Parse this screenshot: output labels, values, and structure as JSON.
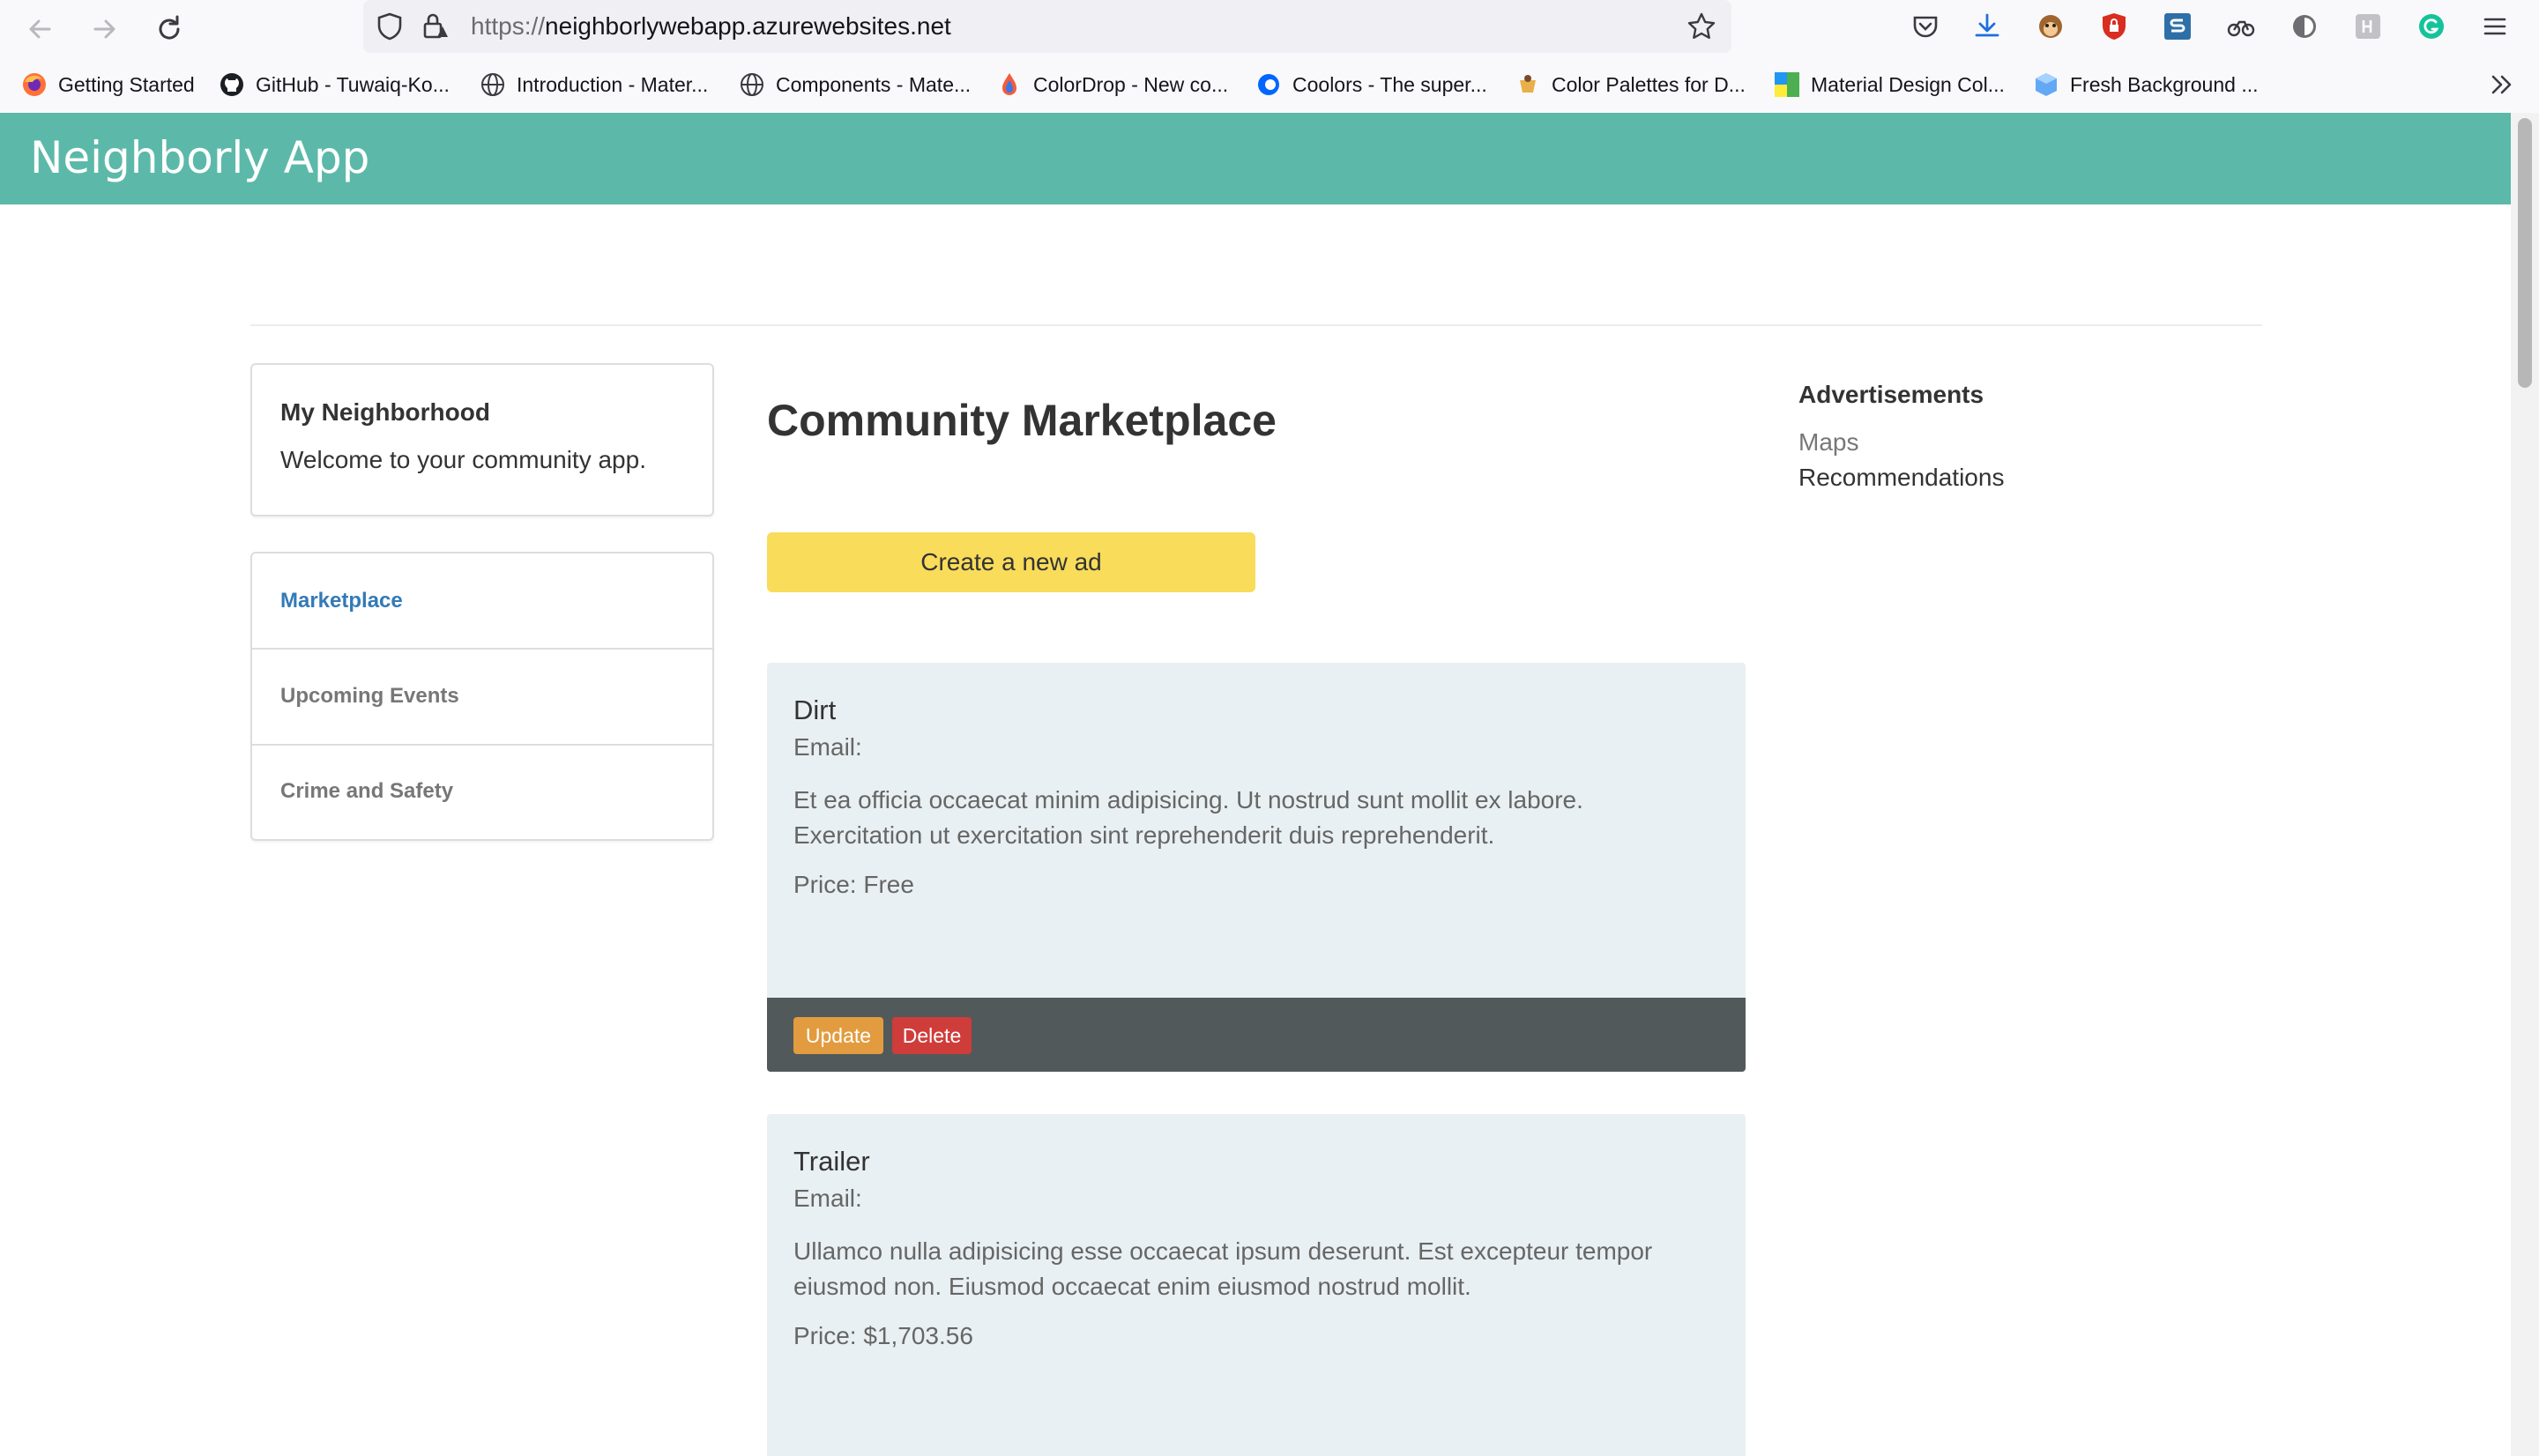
{
  "browser": {
    "url_prefix": "https://",
    "url_host": "neighborlywebapp.azurewebsites.net",
    "bookmarks": [
      {
        "label": "Getting Started",
        "icon": "firefox-icon"
      },
      {
        "label": "GitHub - Tuwaiq-Ko...",
        "icon": "github-icon"
      },
      {
        "label": "Introduction - Mater...",
        "icon": "globe-icon"
      },
      {
        "label": "Components - Mate...",
        "icon": "globe-icon"
      },
      {
        "label": "ColorDrop - New co...",
        "icon": "colordrop-icon"
      },
      {
        "label": "Coolors - The super...",
        "icon": "coolors-icon"
      },
      {
        "label": "Color Palettes for D...",
        "icon": "palette-icon"
      },
      {
        "label": "Material Design Col...",
        "icon": "material-colors-icon"
      },
      {
        "label": "Fresh Background ...",
        "icon": "background-icon"
      }
    ]
  },
  "app": {
    "title": "Neighborly App"
  },
  "intro": {
    "title": "My Neighborhood",
    "text": "Welcome to your community app."
  },
  "nav": [
    {
      "label": "Marketplace",
      "active": true
    },
    {
      "label": "Upcoming Events",
      "active": false
    },
    {
      "label": "Crime and Safety",
      "active": false
    }
  ],
  "main": {
    "title": "Community Marketplace",
    "create_label": "Create a new ad",
    "ads": [
      {
        "title": "Dirt",
        "email": "Email:",
        "description": "Et ea officia occaecat minim adipisicing. Ut nostrud sunt mollit ex labore. Exercitation ut exercitation sint reprehenderit duis reprehenderit.",
        "price": "Price: Free",
        "update_label": "Update",
        "delete_label": "Delete"
      },
      {
        "title": "Trailer",
        "email": "Email:",
        "description": "Ullamco nulla adipisicing esse occaecat ipsum deserunt. Est excepteur tempor eiusmod non. Eiusmod occaecat enim eiusmod nostrud mollit.",
        "price": "Price: $1,703.56"
      }
    ]
  },
  "sidebar_right": {
    "title": "Advertisements",
    "links": [
      "Maps",
      "Recommendations"
    ]
  },
  "colors": {
    "header": "#5cb9a9",
    "create_button": "#f8dc5a",
    "card_bg": "#e9f0f3",
    "card_footer": "#52595b",
    "update_button": "#e29c3f",
    "delete_button": "#cf3d3a",
    "active_link": "#337ab7"
  }
}
